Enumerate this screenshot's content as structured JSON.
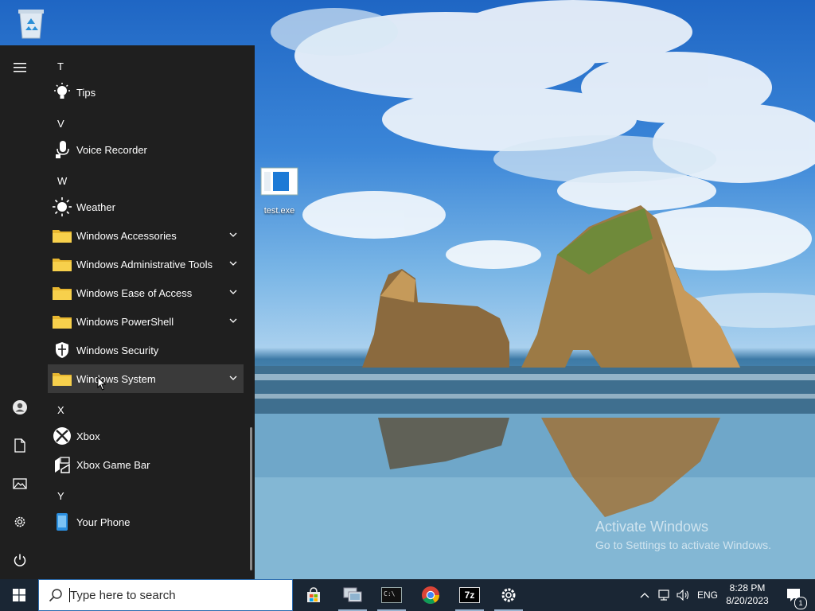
{
  "desktop": {
    "recycle_bin_label": "",
    "file_icon_label": "test.exe",
    "watermark": {
      "line1": "Activate Windows",
      "line2": "Go to Settings to activate Windows."
    }
  },
  "start_menu": {
    "sections": [
      {
        "letter": "T",
        "apps": [
          {
            "name": "Tips",
            "icon": "lightbulb-icon",
            "expandable": false
          }
        ]
      },
      {
        "letter": "V",
        "apps": [
          {
            "name": "Voice Recorder",
            "icon": "microphone-icon",
            "expandable": false
          }
        ]
      },
      {
        "letter": "W",
        "apps": [
          {
            "name": "Weather",
            "icon": "sun-icon",
            "expandable": false
          },
          {
            "name": "Windows Accessories",
            "icon": "folder-icon",
            "expandable": true
          },
          {
            "name": "Windows Administrative Tools",
            "icon": "folder-icon",
            "expandable": true
          },
          {
            "name": "Windows Ease of Access",
            "icon": "folder-icon",
            "expandable": true
          },
          {
            "name": "Windows PowerShell",
            "icon": "folder-icon",
            "expandable": true
          },
          {
            "name": "Windows Security",
            "icon": "shield-icon",
            "expandable": false
          },
          {
            "name": "Windows System",
            "icon": "folder-icon",
            "expandable": true
          }
        ]
      },
      {
        "letter": "X",
        "apps": [
          {
            "name": "Xbox",
            "icon": "xbox-icon",
            "expandable": false
          },
          {
            "name": "Xbox Game Bar",
            "icon": "xbox-game-bar-icon",
            "expandable": false
          }
        ]
      },
      {
        "letter": "Y",
        "apps": [
          {
            "name": "Your Phone",
            "icon": "phone-icon",
            "expandable": false
          }
        ]
      }
    ],
    "rail": [
      "hamburger-icon",
      "user-icon",
      "document-icon",
      "pictures-icon",
      "settings-icon",
      "power-icon"
    ]
  },
  "taskbar": {
    "search_placeholder": "Type here to search",
    "pinned": [
      "store-icon",
      "network-app-icon",
      "command-prompt-icon",
      "chrome-icon",
      "7zip-icon",
      "settings-icon"
    ],
    "sevenzip_label": "7z",
    "cmd_label": "C:\\",
    "language": "ENG",
    "time": "8:28 PM",
    "date": "8/20/2023",
    "notification_count": "1"
  },
  "colors": {
    "start_bg": "#1f1f1f",
    "taskbar_bg": "#1a2634",
    "folder": "#f3c93f",
    "hover": "#3a3a3a"
  }
}
